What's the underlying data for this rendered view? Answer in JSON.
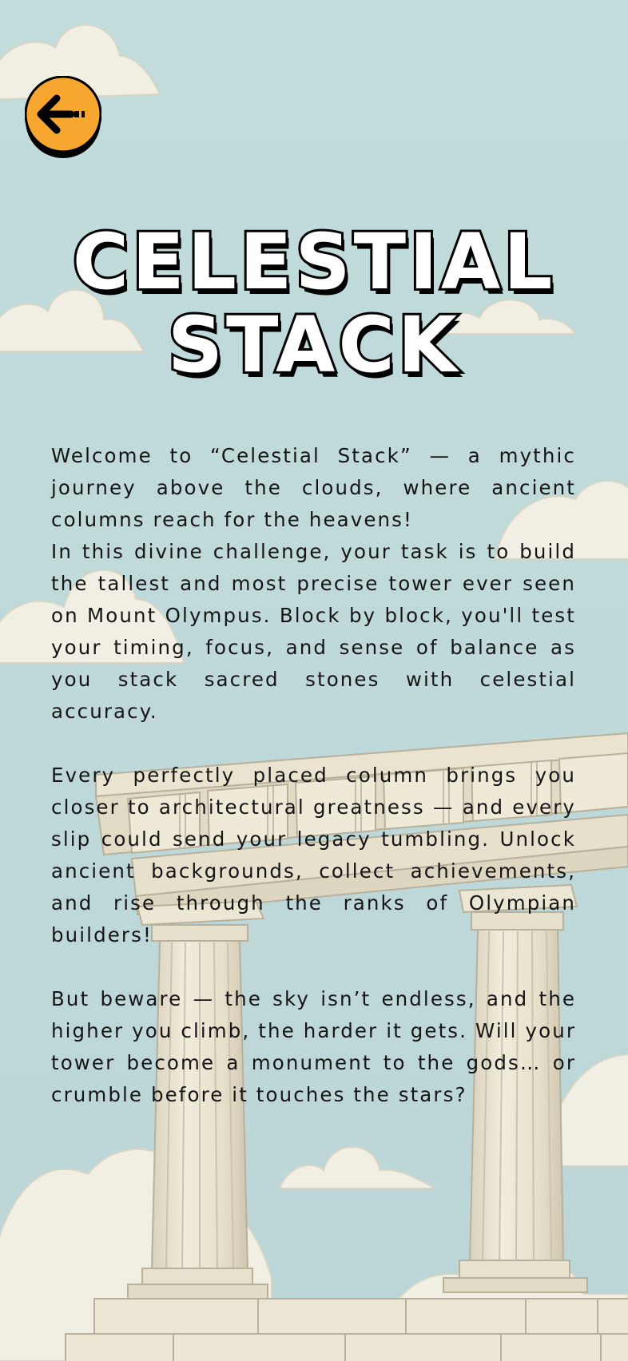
{
  "game": {
    "title_line_1": "CELESTIAL",
    "title_line_2": "STACK",
    "back_label": "Back",
    "paragraphs": [
      "Welcome to “Celestial Stack” — a mythic journey above the clouds, where ancient columns reach for the heavens!",
      "In this divine challenge, your task is to build the tallest and most precise tower ever seen on Mount Olympus. Block by block, you'll test your timing, focus, and sense of balance as you stack sacred stones with celestial accuracy.",
      "Every perfectly placed column brings you closer to architectural greatness — and every slip could send your legacy tumbling. Unlock ancient backgrounds, collect achievements, and rise through the ranks of Olympian builders!",
      "But beware — the sky isn’t endless, and the higher you climb, the harder it gets. Will your tower become a monument to the gods… or crumble before it touches the stars?"
    ]
  },
  "icons": {
    "back": "arrow-left-icon"
  },
  "colors": {
    "sky": "#bfd9da",
    "cloud": "#f1efe3",
    "stone": "#ece6d4",
    "button": "#f7a630",
    "text": "#151515",
    "title_fill": "#ffffff",
    "title_outline": "#000000"
  }
}
